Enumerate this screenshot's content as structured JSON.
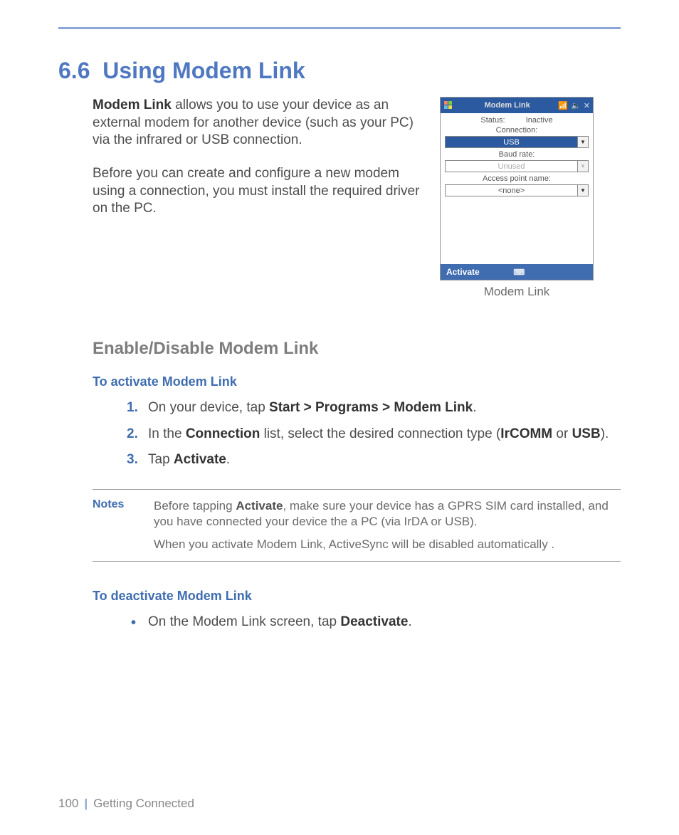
{
  "section": {
    "number": "6.6",
    "title": "Using Modem Link"
  },
  "intro": {
    "p1_lead": "Modem Link",
    "p1_rest": " allows you to use your device as an external modem for another device (such as your PC) via the infrared or USB connection.",
    "p2": "Before you can create and configure a new modem using a connection, you must install the required driver on the PC."
  },
  "screenshot": {
    "title": "Modem Link",
    "status_label": "Status:",
    "status_value": "Inactive",
    "connection_label": "Connection:",
    "connection_value": "USB",
    "baud_label": "Baud rate:",
    "baud_value": "Unused",
    "apn_label": "Access point name:",
    "apn_value": "<none>",
    "activate_btn": "Activate",
    "caption": "Modem Link"
  },
  "subhead": "Enable/Disable Modem Link",
  "activate": {
    "heading": "To activate Modem Link",
    "steps": {
      "s1_a": "On your device, tap ",
      "s1_b": "Start > Programs > Modem Link",
      "s1_c": ".",
      "s2_a": "In the ",
      "s2_b": "Connection",
      "s2_c": " list, select the desired connection type (",
      "s2_d": "IrCOMM",
      "s2_e": " or ",
      "s2_f": "USB",
      "s2_g": ").",
      "s3_a": "Tap ",
      "s3_b": "Activate",
      "s3_c": "."
    }
  },
  "notes": {
    "label": "Notes",
    "n1_a": "Before tapping ",
    "n1_b": "Activate",
    "n1_c": ", make sure your device has a GPRS SIM card installed, and you have connected your device the a PC (via IrDA or USB).",
    "n2": "When you activate Modem Link, ActiveSync will be disabled automatically ."
  },
  "deactivate": {
    "heading": "To deactivate Modem Link",
    "b1_a": "On the Modem Link screen, tap ",
    "b1_b": "Deactivate",
    "b1_c": "."
  },
  "footer": {
    "page": "100",
    "chapter": "Getting Connected"
  }
}
